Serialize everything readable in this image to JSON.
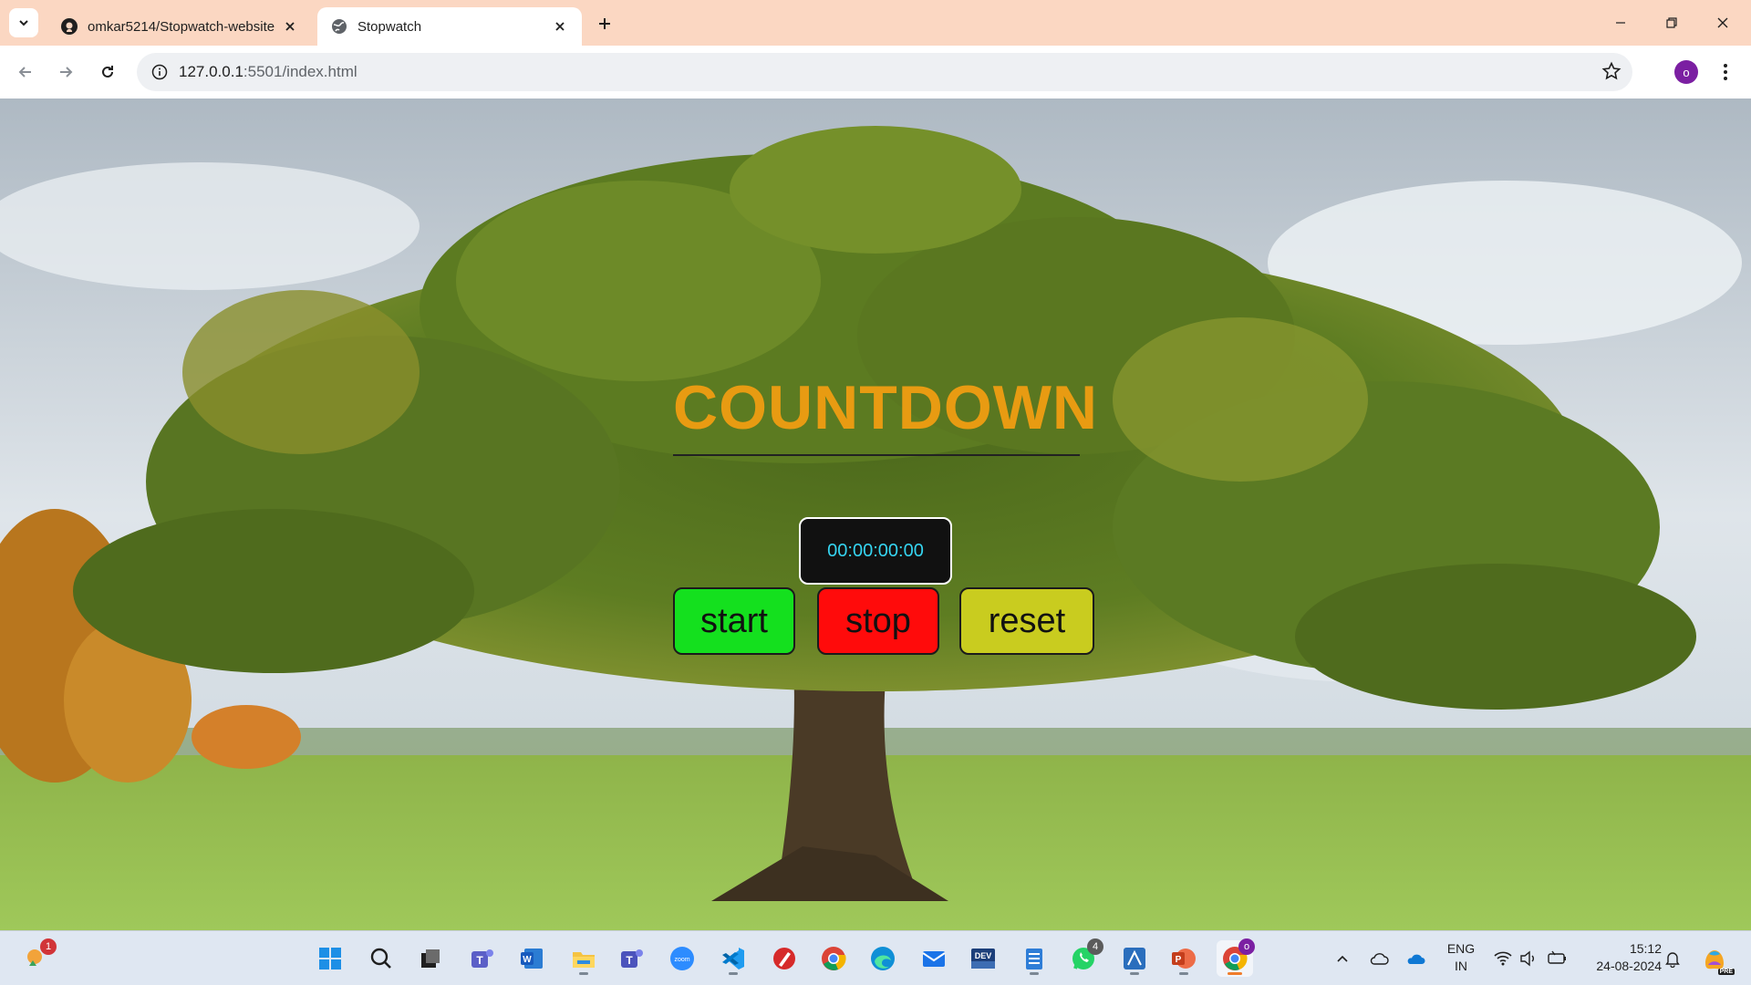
{
  "browser": {
    "tabs": [
      {
        "title": "omkar5214/Stopwatch-website",
        "icon": "github-icon",
        "active": false
      },
      {
        "title": "Stopwatch",
        "icon": "globe-icon",
        "active": true
      }
    ],
    "url_host": "127.0.0.1",
    "url_rest": ":5501/index.html",
    "profile_initial": "o"
  },
  "page": {
    "heading": "COUNTDOWN",
    "timer_display": "00:00:00:00",
    "buttons": {
      "start": "start",
      "stop": "stop",
      "reset": "reset"
    },
    "colors": {
      "heading": "#e89b12",
      "start": "#14e01e",
      "stop": "#ff0b0b",
      "reset": "#c9cc1f",
      "timer_text": "#35d4f0"
    }
  },
  "taskbar": {
    "weather_badge": "1",
    "whatsapp_badge": "4",
    "chrome_badge": "o",
    "dev_label": "DEV",
    "zoom_label": "zoom",
    "language_line1": "ENG",
    "language_line2": "IN",
    "time": "15:12",
    "date": "24-08-2024",
    "copilot_label": "PRE"
  }
}
